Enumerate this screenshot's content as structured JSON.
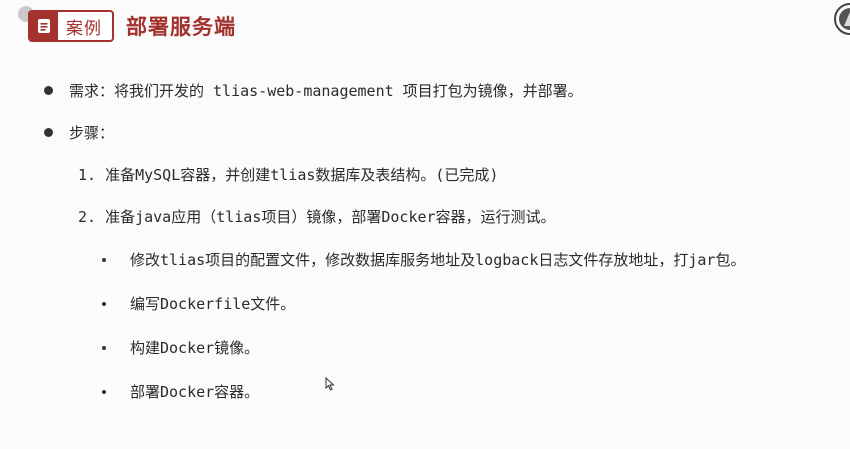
{
  "header": {
    "tag_label": "案例",
    "title": "部署服务端"
  },
  "requirement": "需求：将我们开发的 tlias-web-management 项目打包为镜像，并部署。",
  "steps_label": "步骤：",
  "steps": [
    "1. 准备MySQL容器，并创建tlias数据库及表结构。(已完成)",
    "2. 准备java应用（tlias项目）镜像，部署Docker容器，运行测试。"
  ],
  "substeps": [
    "修改tlias项目的配置文件，修改数据库服务地址及logback日志文件存放地址，打jar包。",
    "编写Dockerfile文件。",
    "构建Docker镜像。",
    "部署Docker容器。"
  ],
  "colors": {
    "accent": "#a3322e"
  },
  "icons": {
    "tag": "document-icon",
    "logo": "logo-icon",
    "cursor": "mouse-cursor-icon"
  }
}
